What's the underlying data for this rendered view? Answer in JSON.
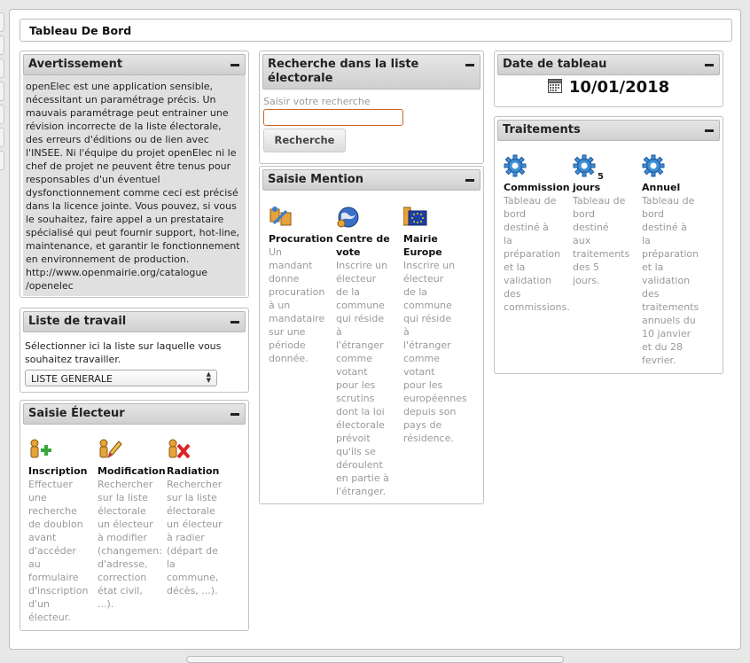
{
  "page_title": "Tableau De Bord",
  "avertissement": {
    "title": "Avertissement",
    "lines": [
      "openElec est une application sensible,",
      "nécessitant un paramétrage précis. Un",
      "mauvais paramétrage peut entrainer une",
      "révision incorrecte de la liste électorale,",
      "des erreurs d'éditions ou de lien avec",
      "l'INSEE. Ni l'équipe du projet openElec ni le",
      "chef de projet ne peuvent être tenus pour",
      "responsables d'un éventuel",
      "dysfonctionnement comme ceci est précisé",
      "dans la licence jointe. Vous pouvez, si vous",
      "le souhaitez, faire appel a un prestataire",
      "spécialisé qui peut fournir support, hot-line,",
      "maintenance, et garantir le fonctionnement",
      "en environnement de production.",
      "http://www.openmairie.org/catalogue",
      "/openelec"
    ]
  },
  "liste_travail": {
    "title": "Liste de travail",
    "text": "Sélectionner ici la liste sur laquelle vous souhaitez travailler.",
    "selected": "LISTE GENERALE"
  },
  "saisie_electeur": {
    "title": "Saisie Électeur",
    "items": [
      {
        "label": "Inscription",
        "icon": "add-user-icon",
        "desc": [
          "Effectuer",
          "une",
          "recherche",
          "de doublon",
          "avant",
          "d'accéder",
          "au",
          "formulaire",
          "d'inscription",
          "d'un",
          "électeur."
        ]
      },
      {
        "label": "Modification",
        "icon": "edit-pencil-icon",
        "desc": [
          "Rechercher",
          "sur la liste",
          "électorale",
          "un électeur",
          "à modifier",
          "(changemen:",
          "d'adresse,",
          "correction",
          "état civil,",
          "...)."
        ]
      },
      {
        "label": "Radiation",
        "icon": "delete-user-icon",
        "desc": [
          "Rechercher",
          "sur la liste",
          "électorale",
          "un électeur",
          "à radier",
          "(départ de",
          "la",
          "commune,",
          "décès, ...)."
        ]
      }
    ]
  },
  "recherche": {
    "title": "Recherche dans la liste électorale",
    "placeholder": "Saisir votre recherche",
    "button": "Recherche"
  },
  "saisie_mention": {
    "title": "Saisie Mention",
    "items": [
      {
        "label": "Procuration",
        "label2": "",
        "icon": "procuration-icon",
        "desc": [
          "Un",
          "mandant",
          "donne",
          "procuration",
          "à un",
          "mandataire",
          "sur une",
          "période",
          "donnée."
        ]
      },
      {
        "label": "Centre de",
        "label2": "vote",
        "icon": "globe-icon",
        "desc": [
          "Inscrire un",
          "électeur",
          "de la",
          "commune",
          "qui réside",
          "à",
          "l'étranger",
          "comme",
          "votant",
          "pour les",
          "scrutins",
          "dont la loi",
          "électorale",
          "prévoit",
          "qu'ils se",
          "déroulent",
          "en partie à",
          "l'étranger."
        ]
      },
      {
        "label": "Mairie",
        "label2": "Europe",
        "icon": "eu-flag-icon",
        "desc": [
          "Inscrire un",
          "électeur",
          "de la",
          "commune",
          "qui réside",
          "à",
          "l'étranger",
          "comme",
          "votant",
          "pour les",
          "européennes",
          "depuis son",
          "pays de",
          "résidence."
        ]
      }
    ]
  },
  "date_tableau": {
    "title": "Date de tableau",
    "date": "10/01/2018"
  },
  "traitements": {
    "title": "Traitements",
    "items": [
      {
        "label": "Commission",
        "badge": "",
        "icon": "gear-icon",
        "desc": [
          "Tableau de",
          "bord",
          "destiné à",
          "la",
          "préparation",
          "et la",
          "validation",
          "des",
          "commissions."
        ]
      },
      {
        "label": "jours",
        "badge": "5",
        "icon": "gear-icon",
        "desc": [
          "Tableau de",
          "bord",
          "destiné",
          "aux",
          "traitements",
          "des 5",
          "jours."
        ]
      },
      {
        "label": "Annuel",
        "badge": "",
        "icon": "gear-icon",
        "desc": [
          "Tableau de",
          "bord",
          "destiné à",
          "la",
          "préparation",
          "et la",
          "validation",
          "des",
          "traitements",
          "annuels du",
          "10 janvier",
          "et du 28",
          "fevrier."
        ]
      }
    ]
  },
  "colors": {
    "accent_input_border": "#d0622b",
    "header_bg": "#d6d6d6",
    "muted_text": "#9a9a9a"
  }
}
